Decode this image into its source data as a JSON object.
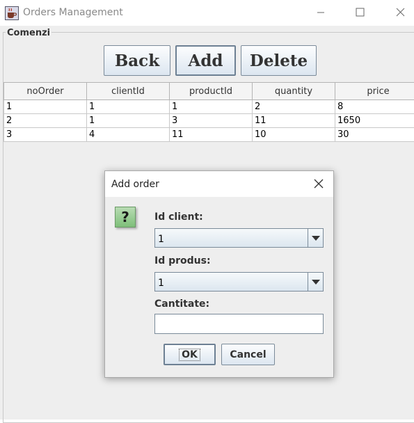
{
  "window": {
    "title": "Orders Management",
    "icon": "java-cup-icon"
  },
  "window_controls": [
    "minimize-icon",
    "maximize-icon",
    "close-icon"
  ],
  "panel": {
    "title": "Comenzi"
  },
  "toolbar": {
    "back_label": "Back",
    "add_label": "Add",
    "delete_label": "Delete"
  },
  "table": {
    "columns": [
      "noOrder",
      "clientId",
      "productId",
      "quantity",
      "price"
    ],
    "rows": [
      [
        "1",
        "1",
        "1",
        "2",
        "8"
      ],
      [
        "2",
        "1",
        "3",
        "11",
        "1650"
      ],
      [
        "3",
        "4",
        "11",
        "10",
        "30"
      ]
    ]
  },
  "dialog": {
    "title": "Add order",
    "icon": "question-icon",
    "icon_glyph": "?",
    "client_label": "Id client:",
    "client_value": "1",
    "product_label": "Id produs:",
    "product_value": "1",
    "quantity_label": "Cantitate:",
    "quantity_value": "",
    "ok_label": "OK",
    "cancel_label": "Cancel"
  },
  "colors": {
    "background": "#eeeeee",
    "button_gradient_top": "#fcfdfe",
    "button_gradient_bottom": "#dce6f0",
    "border": "#7a8a99",
    "question_icon": "#8fc98a"
  }
}
